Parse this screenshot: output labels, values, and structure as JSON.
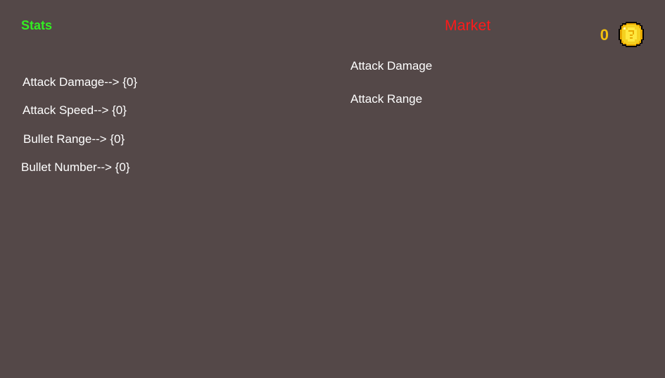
{
  "stats": {
    "title": "Stats",
    "lines": [
      "Attack Damage--> {0}",
      "Attack Speed--> {0}",
      "Bullet Range--> {0}",
      "Bullet Number--> {0}"
    ]
  },
  "market": {
    "title": "Market",
    "items": [
      "Attack Damage",
      "Attack Range"
    ]
  },
  "currency": {
    "coins": "0",
    "icon": "gold-coin-icon"
  },
  "colors": {
    "background": "#544848",
    "stats_title": "#33ee22",
    "market_title": "#ff1a1a",
    "coin_text": "#f2c010",
    "text": "#ffffff"
  }
}
